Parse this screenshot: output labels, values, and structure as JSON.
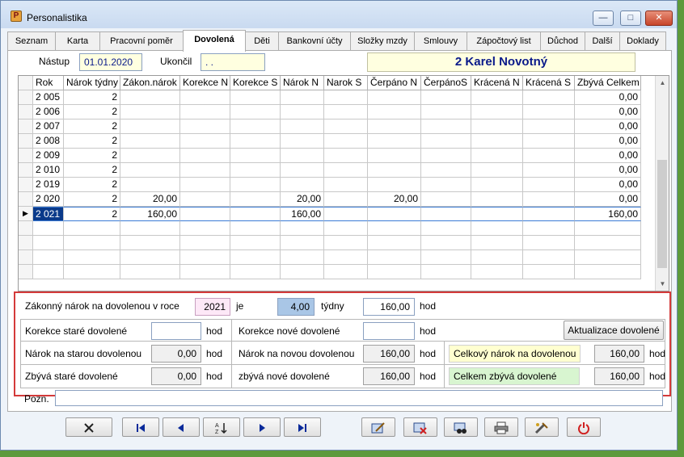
{
  "window": {
    "title": "Personalistika",
    "app_icon_glyph": "P",
    "minimize_glyph": "—",
    "maximize_glyph": "□",
    "close_glyph": "✕"
  },
  "tabs": [
    {
      "label": "Seznam",
      "active": false
    },
    {
      "label": "Karta",
      "active": false
    },
    {
      "label": "Pracovní poměr",
      "active": false
    },
    {
      "label": "Dovolená",
      "active": true
    },
    {
      "label": "Děti",
      "active": false
    },
    {
      "label": "Bankovní účty",
      "active": false
    },
    {
      "label": "Složky mzdy",
      "active": false
    },
    {
      "label": "Smlouvy",
      "active": false
    },
    {
      "label": "Zápočtový list",
      "active": false
    },
    {
      "label": "Důchod",
      "active": false
    },
    {
      "label": "Další",
      "active": false
    },
    {
      "label": "Doklady",
      "active": false
    }
  ],
  "header": {
    "nastup_label": "Nástup",
    "nastup_value": "01.01.2020",
    "ukoncil_label": "Ukončil",
    "ukoncil_value": ". .",
    "employee_name": "2 Karel Novotný"
  },
  "grid": {
    "columns": [
      "Rok",
      "Nárok týdny",
      "Zákon.nárok",
      "Korekce N",
      "Korekce S",
      "Nárok N",
      "Narok S",
      "Čerpáno N",
      "ČerpánoS",
      "Krácená N",
      "Krácená S",
      "Zbývá Celkem"
    ],
    "rows": [
      {
        "cells": [
          "2 005",
          "2",
          "",
          "",
          "",
          "",
          "",
          "",
          "",
          "",
          "",
          "0,00"
        ],
        "selected": false
      },
      {
        "cells": [
          "2 006",
          "2",
          "",
          "",
          "",
          "",
          "",
          "",
          "",
          "",
          "",
          "0,00"
        ],
        "selected": false
      },
      {
        "cells": [
          "2 007",
          "2",
          "",
          "",
          "",
          "",
          "",
          "",
          "",
          "",
          "",
          "0,00"
        ],
        "selected": false
      },
      {
        "cells": [
          "2 008",
          "2",
          "",
          "",
          "",
          "",
          "",
          "",
          "",
          "",
          "",
          "0,00"
        ],
        "selected": false
      },
      {
        "cells": [
          "2 009",
          "2",
          "",
          "",
          "",
          "",
          "",
          "",
          "",
          "",
          "",
          "0,00"
        ],
        "selected": false
      },
      {
        "cells": [
          "2 010",
          "2",
          "",
          "",
          "",
          "",
          "",
          "",
          "",
          "",
          "",
          "0,00"
        ],
        "selected": false
      },
      {
        "cells": [
          "2 019",
          "2",
          "",
          "",
          "",
          "",
          "",
          "",
          "",
          "",
          "",
          "0,00"
        ],
        "selected": false
      },
      {
        "cells": [
          "2 020",
          "2",
          "20,00",
          "",
          "",
          "20,00",
          "",
          "20,00",
          "",
          "",
          "",
          "0,00"
        ],
        "selected": false
      },
      {
        "cells": [
          "2 021",
          "2",
          "160,00",
          "",
          "",
          "160,00",
          "",
          "",
          "",
          "",
          "",
          "160,00"
        ],
        "selected": true
      }
    ],
    "current_row_marker": "▶"
  },
  "summary": {
    "zakonny_label": "Zákonný nárok na dovolenou v roce",
    "zakonny_year": "2021",
    "je_label": "je",
    "weeks_value": "4,00",
    "weeks_unit": "týdny",
    "hours_value": "160,00",
    "hod": "hod",
    "korekce_stare_label": "Korekce staré dovolené",
    "korekce_stare_value": "",
    "korekce_nove_label": "Korekce nové dovolené",
    "korekce_nove_value": "",
    "aktualizace_button": "Aktualizace dovolené",
    "narok_stara_label": "Nárok na starou dovolenou",
    "narok_stara_value": "0,00",
    "narok_nova_label": "Nárok na novou dovolenou",
    "narok_nova_value": "160,00",
    "celkovy_narok_label": "Celkový nárok na dovolenou",
    "celkovy_narok_value": "160,00",
    "zbyva_stare_label": "Zbývá staré dovolené",
    "zbyva_stare_value": "0,00",
    "zbyva_nove_label": "zbývá nové dovolené",
    "zbyva_nove_value": "160,00",
    "celkem_zbyva_label": "Celkem zbývá dovolené",
    "celkem_zbyva_value": "160,00"
  },
  "pozn_label": "Pozn.",
  "pozn_value": "",
  "toolbar": {
    "icons": [
      "cancel-icon",
      "first-record-icon",
      "previous-record-icon",
      "sort-icon",
      "next-record-icon",
      "last-record-icon",
      "edit-icon",
      "delete-icon",
      "find-icon",
      "print-icon",
      "tools-icon",
      "power-icon"
    ]
  },
  "colors": {
    "accent_red": "#d43a3a",
    "selected_cell": "#0a3a8a",
    "name_text": "#0a1a8a"
  }
}
